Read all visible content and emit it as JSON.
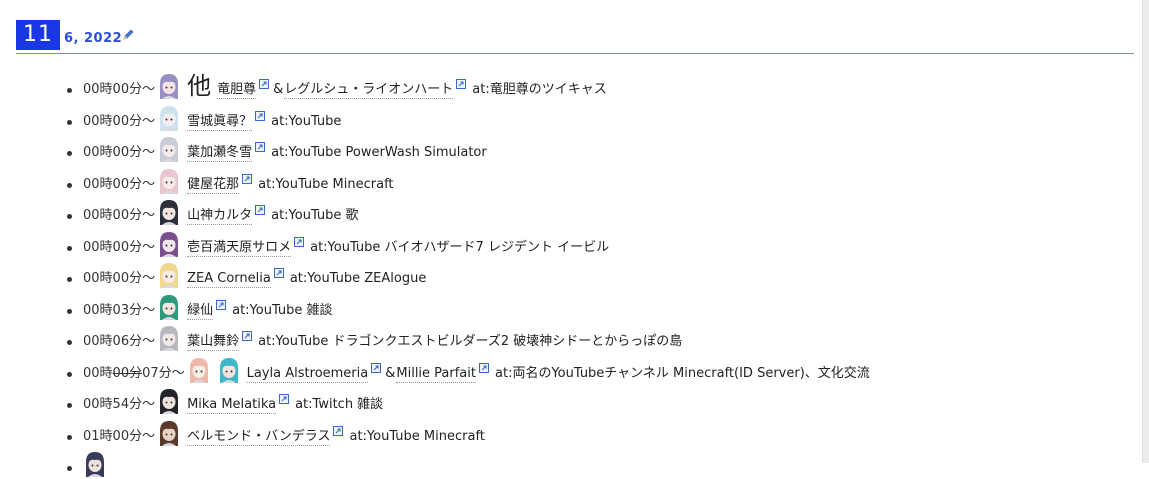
{
  "header": {
    "day": "11",
    "month_year": "6, 2022",
    "edit_icon": "pencil-icon"
  },
  "colors": {
    "day_box_bg": "#1937e6",
    "month_year_text": "#2a4fd6",
    "header_rule": "#7a8aa8"
  },
  "schedule": [
    {
      "time": "00時00分～",
      "other": "他",
      "avatars": [
        {
          "hair": "#9a8fc4",
          "skin": "#f4e4e6"
        }
      ],
      "talents": [
        "竜胆尊",
        "レグルシュ・ライオンハート"
      ],
      "at": "at:竜胆尊のツイキャス"
    },
    {
      "time": "00時00分～",
      "avatars": [
        {
          "hair": "#cfe3ee",
          "skin": "#f6eef0"
        }
      ],
      "talents": [
        "雪城眞尋？"
      ],
      "at": "at:YouTube"
    },
    {
      "time": "00時00分～",
      "avatars": [
        {
          "hair": "#c9ccd6",
          "skin": "#f4eceb"
        }
      ],
      "talents": [
        "葉加瀬冬雪"
      ],
      "at": "at:YouTube PowerWash Simulator"
    },
    {
      "time": "00時00分～",
      "avatars": [
        {
          "hair": "#e9c6cf",
          "skin": "#f7ecec"
        }
      ],
      "talents": [
        "健屋花那"
      ],
      "at": "at:YouTube Minecraft"
    },
    {
      "time": "00時00分～",
      "avatars": [
        {
          "hair": "#2a2f3a",
          "skin": "#f2e4e0"
        }
      ],
      "talents": [
        "山神カルタ"
      ],
      "at": "at:YouTube 歌"
    },
    {
      "time": "00時00分～",
      "avatars": [
        {
          "hair": "#7a4f8e",
          "skin": "#f4e6ec"
        }
      ],
      "talents": [
        "壱百満天原サロメ"
      ],
      "at": "at:YouTube バイオハザード7 レジデント イービル"
    },
    {
      "time": "00時00分～",
      "avatars": [
        {
          "hair": "#f0d890",
          "skin": "#f7ebe4"
        }
      ],
      "talents": [
        "ZEA Cornelia"
      ],
      "at": "at:YouTube ZEAlogue"
    },
    {
      "time": "00時03分～",
      "avatars": [
        {
          "hair": "#2f9a7a",
          "skin": "#f0e6df"
        }
      ],
      "talents": [
        "緑仙"
      ],
      "at": "at:YouTube 雑談"
    },
    {
      "time": "00時06分～",
      "avatars": [
        {
          "hair": "#b8b8c0",
          "skin": "#f3e8e4"
        }
      ],
      "talents": [
        "葉山舞鈴"
      ],
      "at": "at:YouTube ドラゴンクエストビルダーズ2 破壊神シドーとからっぽの島"
    },
    {
      "time_prefix": "00時",
      "time_struck": "00分",
      "time_suffix": "07分～",
      "avatars": [
        {
          "hair": "#f0b8a8",
          "skin": "#f8ece6"
        },
        {
          "hair": "#3fb6c8",
          "skin": "#f4e2de"
        }
      ],
      "talents": [
        "Layla Alstroemeria",
        "Millie Parfait"
      ],
      "at": "at:両名のYouTubeチャンネル Minecraft(ID Server)、文化交流"
    },
    {
      "time": "00時54分～",
      "avatars": [
        {
          "hair": "#24242c",
          "skin": "#efe2dc"
        }
      ],
      "talents": [
        "Mika Melatika"
      ],
      "at": "at:Twitch 雑談"
    },
    {
      "time": "01時00分～",
      "avatars": [
        {
          "hair": "#5a3a2a",
          "skin": "#e8d2c4"
        }
      ],
      "talents": [
        "ベルモンド・バンデラス"
      ],
      "at": "at:YouTube Minecraft"
    },
    {
      "time": "",
      "avatars": [
        {
          "hair": "#3a3a5a",
          "skin": "#ece0dc"
        }
      ],
      "talents": [],
      "at": ""
    }
  ]
}
